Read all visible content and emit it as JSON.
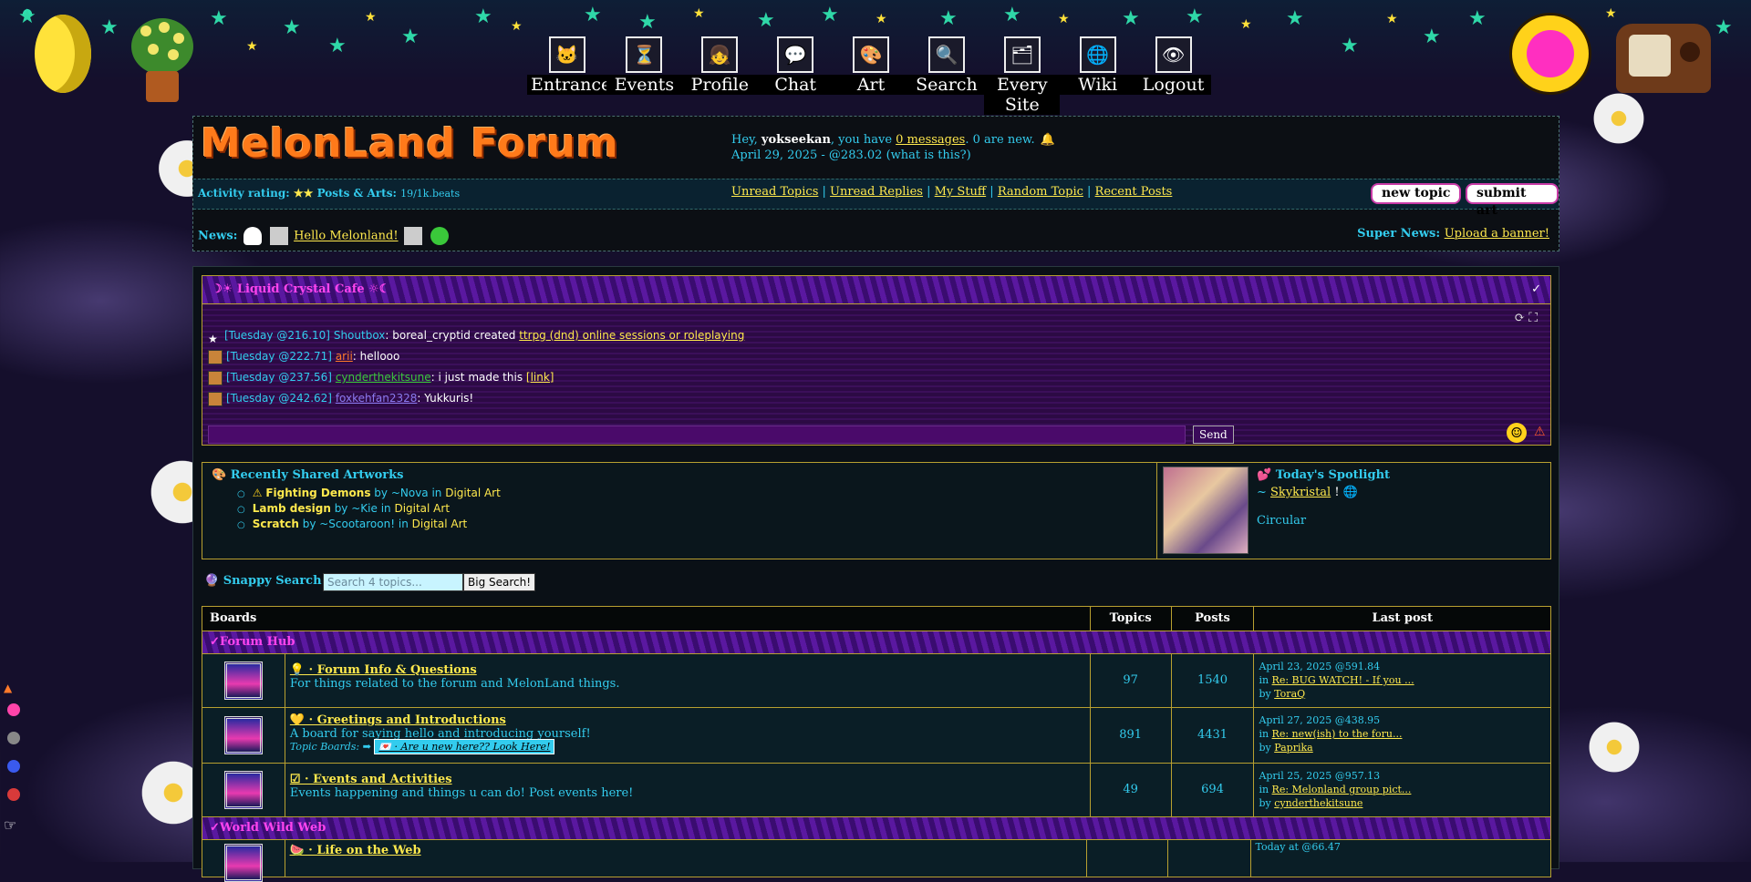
{
  "nav": [
    {
      "label": "Entrance",
      "icon": "cat-face-icon"
    },
    {
      "label": "Events",
      "icon": "hourglass-icon"
    },
    {
      "label": "Profile",
      "icon": "girl-portrait-icon"
    },
    {
      "label": "Chat",
      "icon": "chat-bubble-icon"
    },
    {
      "label": "Art",
      "icon": "palette-icon"
    },
    {
      "label": "Search",
      "icon": "magnifier-icon"
    },
    {
      "label": "Every Site",
      "icon": "sites-grid-icon"
    },
    {
      "label": "Wiki",
      "icon": "globe-icon"
    },
    {
      "label": "Logout",
      "icon": "logout-eye-icon"
    }
  ],
  "header": {
    "logo": "MelonLand Forum",
    "greet_pre": "Hey, ",
    "username": "yokseekan",
    "greet_mid": ", you have ",
    "messages_link": "0 messages",
    "greet_post": ". 0 are new.",
    "date": "April 29, 2025 - @283.02",
    "what": "(what is this?)",
    "activity_label": "Activity rating:",
    "activity_stars": "★★",
    "posts_arts_label": "Posts & Arts:",
    "posts_arts_value": "19/1k.beats",
    "links": [
      "Unread Topics",
      "Unread Replies",
      "My Stuff",
      "Random Topic",
      "Recent Posts"
    ],
    "new_topic": "new topic",
    "submit_art": "submit art",
    "news_label": "News:",
    "news_link": "Hello Melonland!",
    "supernews_label": "Super News:",
    "supernews_link": "Upload a banner!"
  },
  "chat": {
    "title": "☽☀ Liquid Crystal Cafe ☼☾",
    "check": "✓",
    "tools": "⟳⛶",
    "messages": [
      {
        "ts": "[Tuesday @216.10]",
        "name": "Shoutbox",
        "sep": ": ",
        "text": "boreal_cryptid created ",
        "link": "ttrpg (dnd) online sessions or roleplaying",
        "name_color": "#33ccee"
      },
      {
        "ts": "[Tuesday @222.71]",
        "name": "arii",
        "sep": ": ",
        "text": "hellooo",
        "link": "",
        "name_color": "#ff7a2a"
      },
      {
        "ts": "[Tuesday @237.56]",
        "name": "cynderthekitsune",
        "sep": ": ",
        "text": "i just made this ",
        "link": "[link]",
        "name_color": "#3ac83a"
      },
      {
        "ts": "[Tuesday @242.62]",
        "name": "foxkehfan2328",
        "sep": ": ",
        "text": "Yukkuris!",
        "link": "",
        "name_color": "#8a7aee"
      }
    ],
    "send": "Send",
    "smile": "☺",
    "warn": "⚠"
  },
  "art": {
    "title": "Recently Shared Artworks",
    "items": [
      {
        "warn": "⚠",
        "title": "Fighting Demons",
        "by": " by ~Nova",
        "in": " in ",
        "cat": "Digital Art"
      },
      {
        "warn": "",
        "title": "Lamb design",
        "by": " by ~Kie",
        "in": " in ",
        "cat": "Digital Art"
      },
      {
        "warn": "",
        "title": "Scratch",
        "by": " by ~Scootaroon!",
        "in": " in ",
        "cat": "Digital Art"
      }
    ],
    "spotlight_title": "Today's Spotlight",
    "spotlight_tilde": "~ ",
    "spotlight_name": "Skykristal",
    "spotlight_bang": " !",
    "spotlight_desc": "Circular"
  },
  "search": {
    "label": "Snappy Search! ~",
    "placeholder": "Search 4 topics...",
    "button": "Big Search!"
  },
  "table": {
    "headers": {
      "boards": "Boards",
      "topics": "Topics",
      "posts": "Posts",
      "last": "Last post"
    },
    "categories": [
      "Forum Hub",
      "World Wild Web"
    ],
    "boards": [
      {
        "name": "💡 · Forum Info & Questions",
        "desc": "For things related to the forum and MelonLand things.",
        "topics": "97",
        "posts": "1540",
        "date": "April 23, 2025 @591.84",
        "in": "in ",
        "topic": "Re: BUG WATCH! - If you ...",
        "by": "by ",
        "user": "ToraQ",
        "sub_label": "",
        "sub_link": ""
      },
      {
        "name": "💛 · Greetings and Introductions",
        "desc": "A board for saying hello and introducing yourself!",
        "topics": "891",
        "posts": "4431",
        "date": "April 27, 2025 @438.95",
        "in": "in ",
        "topic": "Re: new(ish) to the foru...",
        "by": "by ",
        "user": "Paprika",
        "sub_label": "Topic Boards: ➡ ",
        "sub_link": "💌 · Are u new here?? Look Here!"
      },
      {
        "name": "☑ · Events and Activities",
        "desc": "Events happening and things u can do! Post events here!",
        "topics": "49",
        "posts": "694",
        "date": "April 25, 2025 @957.13",
        "in": "in ",
        "topic": "Re: Melonland group pict...",
        "by": "by ",
        "user": "cynderthekitsune",
        "sub_label": "",
        "sub_link": ""
      }
    ],
    "next_board_name": "🍉 · Life on the Web",
    "next_board_date": "Today at @66.47"
  },
  "colors": {
    "accent": "#33ccee",
    "link": "#ffe94d",
    "category": "#ff44ee",
    "border": "#b8a030"
  }
}
